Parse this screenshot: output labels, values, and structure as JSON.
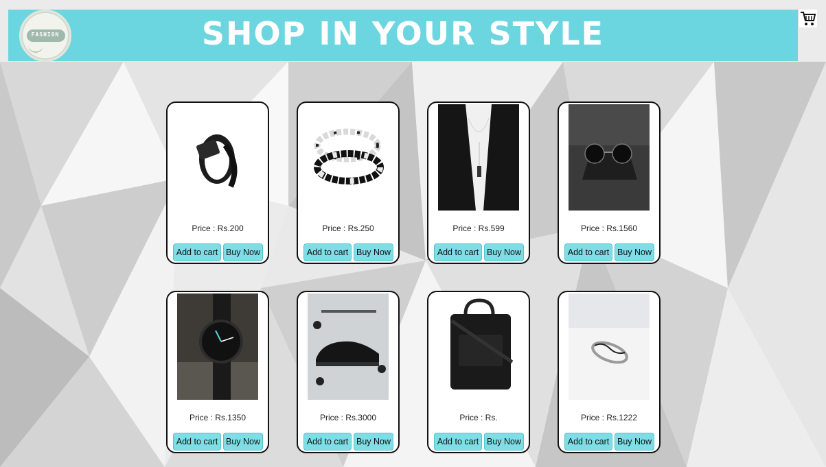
{
  "header": {
    "title": "SHOP IN YOUR STYLE",
    "logo_text": "FASHION",
    "cart_icon": "shopping-cart-icon",
    "banner_color": "#6cd6e0"
  },
  "buttons": {
    "add_to_cart": "Add to cart",
    "buy_now": "Buy Now"
  },
  "products": [
    {
      "price": "Price : Rs.200",
      "image": "belt"
    },
    {
      "price": "Price : Rs.250",
      "image": "bead-bracelets"
    },
    {
      "price": "Price : Rs.599",
      "image": "pendant-necklace"
    },
    {
      "price": "Price : Rs.1560",
      "image": "sunglasses"
    },
    {
      "price": "Price : Rs.1350",
      "image": "wrist-watch"
    },
    {
      "price": "Price : Rs.3000",
      "image": "sneaker"
    },
    {
      "price": "Price : Rs.",
      "image": "laptop-bag"
    },
    {
      "price": "Price : Rs.1222",
      "image": "silver-ring"
    }
  ]
}
